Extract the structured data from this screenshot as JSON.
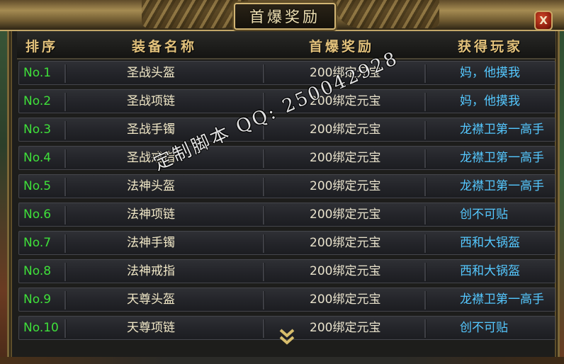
{
  "window": {
    "title": "首爆奖励",
    "close_label": "X"
  },
  "columns": {
    "rank": "排序",
    "item": "装备名称",
    "reward": "首爆奖励",
    "player": "获得玩家"
  },
  "rows": [
    {
      "rank": "No.1",
      "item": "圣战头盔",
      "reward": "200绑定元宝",
      "player": "妈，他摸我"
    },
    {
      "rank": "No.2",
      "item": "圣战项链",
      "reward": "200绑定元宝",
      "player": "妈，他摸我"
    },
    {
      "rank": "No.3",
      "item": "圣战手镯",
      "reward": "200绑定元宝",
      "player": "龙襟卫第一高手"
    },
    {
      "rank": "No.4",
      "item": "圣战戒指",
      "reward": "200绑定元宝",
      "player": "龙襟卫第一高手"
    },
    {
      "rank": "No.5",
      "item": "法神头盔",
      "reward": "200绑定元宝",
      "player": "龙襟卫第一高手"
    },
    {
      "rank": "No.6",
      "item": "法神项链",
      "reward": "200绑定元宝",
      "player": "创不可贴"
    },
    {
      "rank": "No.7",
      "item": "法神手镯",
      "reward": "200绑定元宝",
      "player": "西和大锅盔"
    },
    {
      "rank": "No.8",
      "item": "法神戒指",
      "reward": "200绑定元宝",
      "player": "西和大锅盔"
    },
    {
      "rank": "No.9",
      "item": "天尊头盔",
      "reward": "200绑定元宝",
      "player": "龙襟卫第一高手"
    },
    {
      "rank": "No.10",
      "item": "天尊项链",
      "reward": "200绑定元宝",
      "player": "创不可贴"
    }
  ],
  "watermark": "定制脚本 QQ: 250042928",
  "scroll_icon": "double-chevron-down-icon"
}
